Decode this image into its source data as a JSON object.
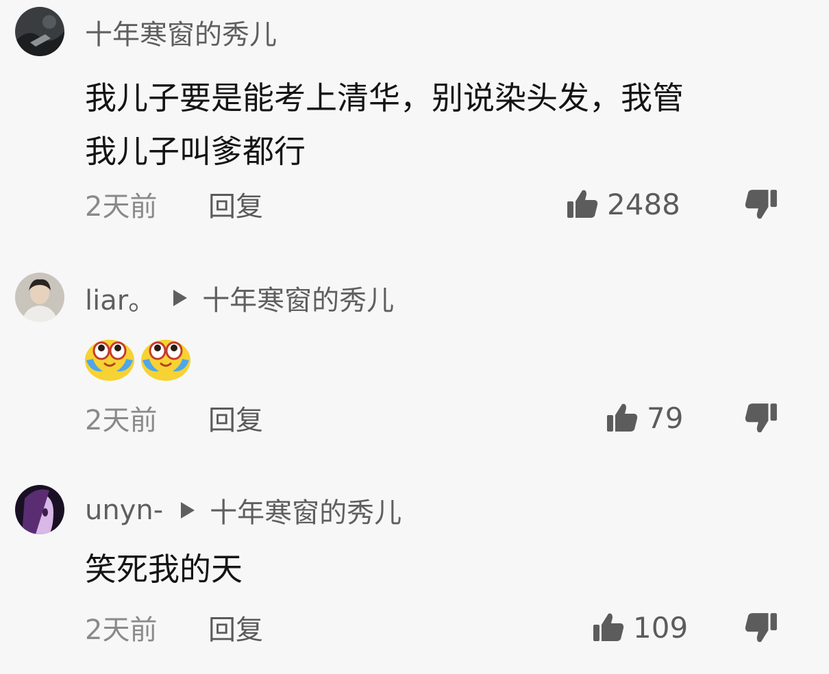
{
  "comments": [
    {
      "username": "十年寒窗的秀儿",
      "reply_to": "",
      "text_line1": "我儿子要是能考上清华，别说染头发，我管",
      "text_line2": "我儿子叫爹都行",
      "time": "2天前",
      "reply_label": "回复",
      "likes": "2488",
      "avatar_icon": "dark-avatar",
      "like_icon": "thumbs-up-icon",
      "dislike_icon": "thumbs-down-icon"
    },
    {
      "username": "liar。",
      "reply_to": "十年寒窗的秀儿",
      "emoji": "crying-laughing-emoji",
      "time": "2天前",
      "reply_label": "回复",
      "likes": "79",
      "avatar_icon": "person-avatar",
      "like_icon": "thumbs-up-icon",
      "dislike_icon": "thumbs-down-icon"
    },
    {
      "username": "unyn-",
      "reply_to": "十年寒窗的秀儿",
      "text_line1": "笑死我的天",
      "time": "2天前",
      "reply_label": "回复",
      "likes": "109",
      "avatar_icon": "purple-anime-avatar",
      "like_icon": "thumbs-up-icon",
      "dislike_icon": "thumbs-down-icon"
    }
  ],
  "colors": {
    "background": "#f7f7f7",
    "username": "#5f5f5f",
    "body_text": "#141414",
    "meta_text": "#8a8a8a",
    "icon": "#5c5c5c"
  }
}
